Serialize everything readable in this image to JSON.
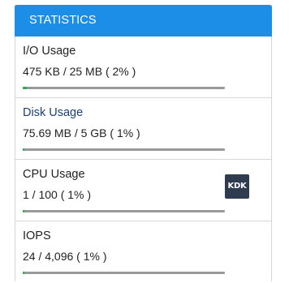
{
  "panel": {
    "title": "STATISTICS"
  },
  "stats": [
    {
      "title": "I/O Usage",
      "value": "475 KB / 25 MB ( 2% )",
      "percent": 2
    },
    {
      "title": "Disk Usage",
      "value": "75.69 MB / 5 GB ( 1% )",
      "percent": 1
    },
    {
      "title": "CPU Usage",
      "value": "1 / 100 ( 1% )",
      "percent": 1
    },
    {
      "title": "IOPS",
      "value": "24 / 4,096 ( 1% )",
      "percent": 1
    }
  ],
  "badge": {
    "text": "KDK"
  },
  "colors": {
    "header": "#1d8ee8",
    "bar_fill": "#2fa84f",
    "bar_track": "#9a9a9a",
    "link": "#1e3f73"
  }
}
